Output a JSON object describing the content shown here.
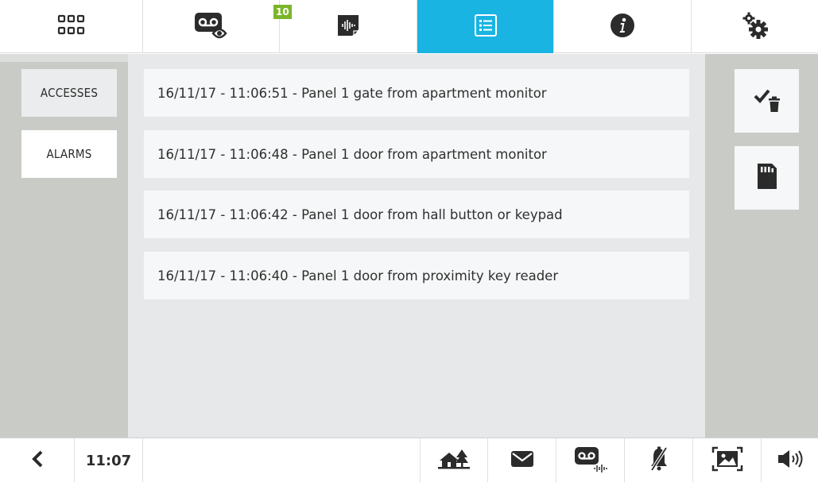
{
  "top_tabs": [
    {
      "name": "apps-grid",
      "icon": "grid-icon"
    },
    {
      "name": "videomemory-viewer",
      "icon": "videomemory-eye-icon",
      "badge": "10"
    },
    {
      "name": "audio-messages",
      "icon": "audio-message-icon"
    },
    {
      "name": "event-log",
      "icon": "list-icon",
      "active": true
    },
    {
      "name": "info",
      "icon": "info-icon"
    },
    {
      "name": "settings",
      "icon": "gears-icon"
    }
  ],
  "sidebar": {
    "items": [
      {
        "label": "ACCESSES",
        "selected": true
      },
      {
        "label": "ALARMS",
        "selected": false
      }
    ]
  },
  "log": {
    "entries": [
      "16/11/17 - 11:06:51 - Panel 1 gate from apartment monitor",
      "16/11/17 - 11:06:48 - Panel 1 door from apartment monitor",
      "16/11/17 - 11:06:42 - Panel 1 door from hall button or keypad",
      "16/11/17 - 11:06:40 - Panel 1 door from proximity key reader"
    ]
  },
  "actions": [
    {
      "name": "check-delete",
      "icon": "check-trash-icon"
    },
    {
      "name": "sd-card",
      "icon": "sd-card-icon"
    }
  ],
  "bottom": {
    "time": "11:07",
    "icons": [
      "back-chevron-icon",
      "home-tree-icon",
      "envelope-icon",
      "videomemory-audio-icon",
      "bell-mute-icon",
      "picture-frame-icon",
      "speaker-icon"
    ]
  },
  "colors": {
    "active_tab": "#1ab4e2",
    "badge": "#7ab52a",
    "panel_gray": "#c9cbc7",
    "list_bg": "#e7e8e9",
    "entry_bg": "#f6f7f8"
  }
}
